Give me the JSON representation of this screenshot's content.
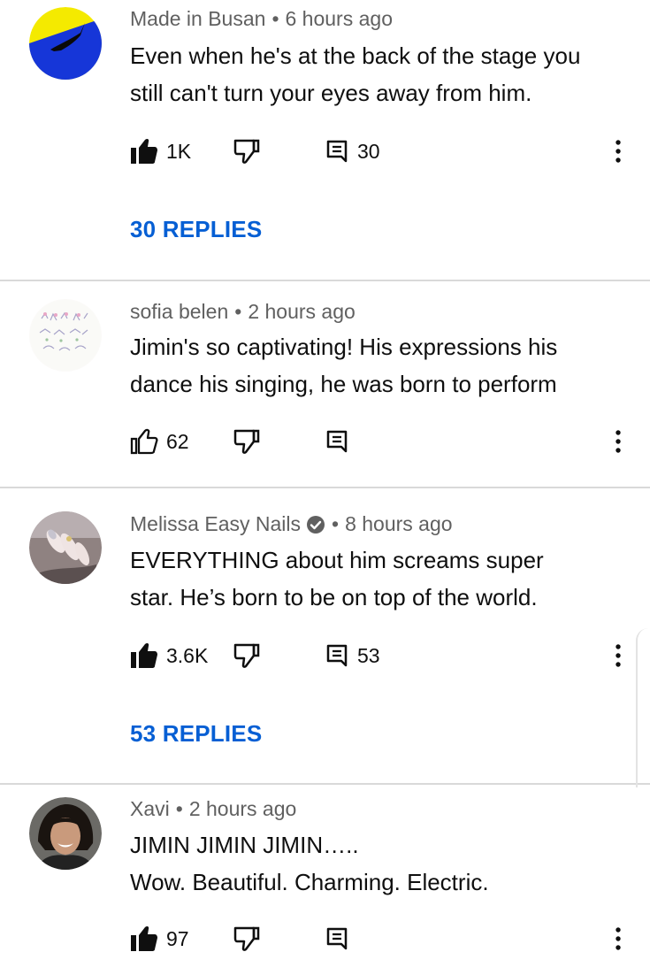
{
  "comments": [
    {
      "author": "Made in Busan",
      "time": "6 hours ago",
      "lines": [
        "Even when he's at the back of the stage you",
        "still can't turn your eyes away from him."
      ],
      "likes": "1K",
      "reply_count": "30",
      "replies_label": "30 REPLIES",
      "liked": true
    },
    {
      "author": "sofia belen",
      "time": "2 hours ago",
      "lines": [
        "Jimin's so captivating! His expressions his",
        "dance his singing, he was born to perform"
      ],
      "likes": "62",
      "reply_count": "",
      "liked": false
    },
    {
      "author": "Melissa Easy Nails",
      "time": "8 hours ago",
      "verified": true,
      "lines": [
        "EVERYTHING about him screams super",
        "star. He’s born to be on top of the world."
      ],
      "likes": "3.6K",
      "reply_count": "53",
      "replies_label": "53 REPLIES",
      "liked": true
    },
    {
      "author": "Xavi",
      "time": "2 hours ago",
      "lines": [
        "JIMIN JIMIN JIMIN…..",
        "Wow. Beautiful. Charming. Electric."
      ],
      "likes": "97",
      "reply_count": "",
      "liked": true
    }
  ],
  "colors": {
    "link": "#065fd4",
    "meta": "#606060",
    "text": "#0f0f0f",
    "divider": "#d9d9d9"
  },
  "icons": [
    "thumbs-up-icon",
    "thumbs-down-icon",
    "reply-icon",
    "more-vertical-icon",
    "verified-icon"
  ]
}
